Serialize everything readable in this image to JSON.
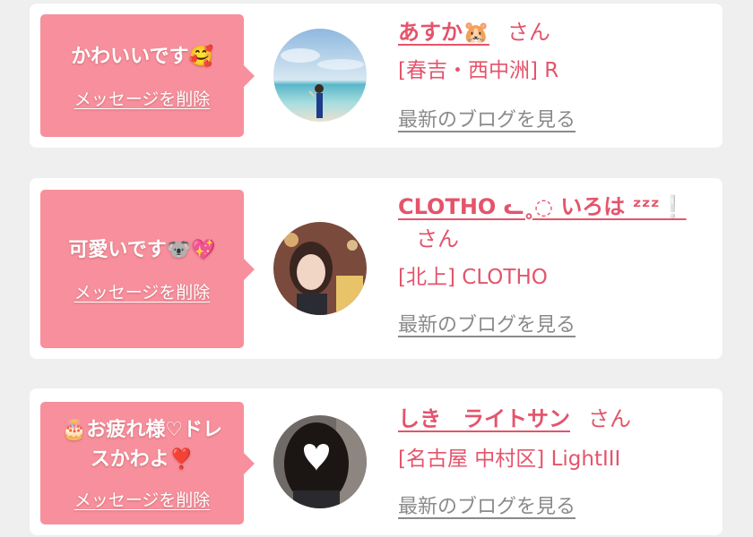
{
  "messages": [
    {
      "message": "かわいいです🥰",
      "delete_label": "メッセージを削除",
      "name": "あすか🐹",
      "honorific": "さん",
      "shop": "[春吉・西中洲] R",
      "blog_label": "最新のブログを見る"
    },
    {
      "message": "可愛いです🐨💖",
      "delete_label": "メッセージを削除",
      "name": "CLOTHO ᓚ˳◌ いろは ᶻᶻᶻ❕",
      "honorific": "さん",
      "shop": "[北上] CLOTHO",
      "blog_label": "最新のブログを見る"
    },
    {
      "message": "🎂お疲れ様♡ドレスかわよ❣️",
      "delete_label": "メッセージを削除",
      "name": "しき　ライトサン",
      "honorific": "さん",
      "shop": "[名古屋 中村区] LightIII",
      "blog_label": "最新のブログを見る"
    }
  ],
  "colors": {
    "accent": "#e4546b",
    "bubble": "#f7909c",
    "link_gray": "#8a8a8a",
    "background": "#efefef"
  }
}
